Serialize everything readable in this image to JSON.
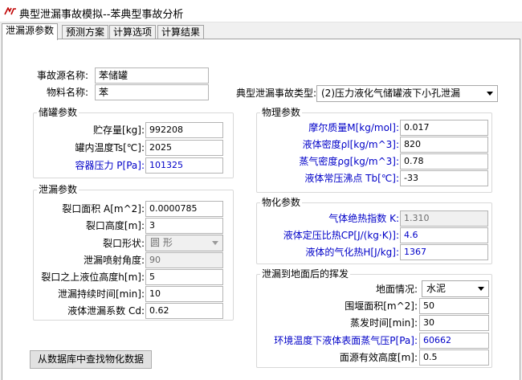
{
  "window": {
    "title": "典型泄漏事故模拟--苯典型事故分析",
    "tabs": [
      "泄漏源参数",
      "预测方案",
      "计算选项",
      "计算结果"
    ]
  },
  "top": {
    "source_name_label": "事故源名称:",
    "source_name_value": "苯储罐",
    "material_label": "物料名称:",
    "material_value": "苯",
    "scenario_label": "典型泄漏事故类型:",
    "scenario_value": "(2)压力液化气储罐液下小孔泄漏"
  },
  "storage": {
    "title": "储罐参数",
    "fields": [
      {
        "label": "贮存量[kg]:",
        "value": "992208"
      },
      {
        "label": "罐内温度Ts[℃]:",
        "value": "2025"
      },
      {
        "label": "容器压力 P[Pa]:",
        "value": "101325"
      }
    ]
  },
  "leak": {
    "title": "泄漏参数",
    "area_label": "裂口面积 A[m^2]:",
    "area_value": "0.0000785",
    "height_label": "裂口高度[m]:",
    "height_value": "3",
    "shape_label": "裂口形状:",
    "shape_value": "圆 形",
    "jet_angle_label": "泄漏喷射角度:",
    "jet_angle_value": "90",
    "level_label": "裂口之上液位高度h[m]:",
    "level_value": "5",
    "duration_label": "泄漏持续时间[min]:",
    "duration_value": "10",
    "coef_label": "液体泄漏系数  Cd:",
    "coef_value": "0.62"
  },
  "physical": {
    "title": "物理参数",
    "fields": [
      {
        "label": "摩尔质量M[kg/mol]:",
        "value": "0.017"
      },
      {
        "label": "液体密度ρl[kg/m^3]:",
        "value": "820"
      },
      {
        "label": "蒸气密度ρg[kg/m^3]:",
        "value": "0.78"
      },
      {
        "label": "液体常压沸点 Tb[℃]:",
        "value": "-33"
      }
    ]
  },
  "chemical": {
    "title": "物化参数",
    "fields": [
      {
        "label": "气体绝热指数  K:",
        "value": "1.310"
      },
      {
        "label": "液体定压比热CP[J/(kg·K)]:",
        "value": "4.6"
      },
      {
        "label": "液体的气化热H[J/kg]:",
        "value": "1367"
      }
    ]
  },
  "evap": {
    "title": "泄漏到地面后的挥发",
    "ground_label": "地面情况:",
    "ground_value": "水泥",
    "dike_label": "围堰面积[m^2]:",
    "dike_value": "50",
    "evap_time_label": "蒸发时间[min]:",
    "evap_time_value": "30",
    "vapor_label": "环境温度下液体表面蒸气压P[Pa]:",
    "vapor_value": "60662",
    "surface_label": "面源有效高度[m]:",
    "surface_value": "0.5"
  },
  "db_button": "从数据库中查找物化数据",
  "colors": {
    "label_blue": "#0000c8",
    "border": "#a0a0a0",
    "face": "#f0f0f0"
  }
}
